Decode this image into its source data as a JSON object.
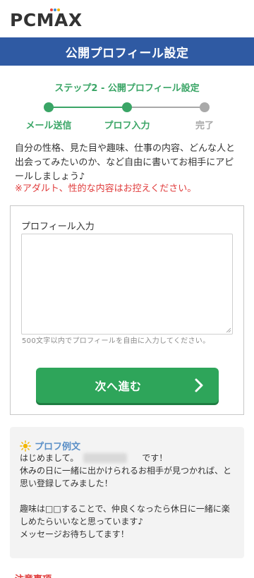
{
  "logo": {
    "text": "PCMAX",
    "dot_colors": [
      "#e8443a",
      "#3a8fd8",
      "#f0b400"
    ]
  },
  "header": {
    "title": "公開プロフィール設定"
  },
  "step_title": "ステップ2 - 公開プロフィール設定",
  "stepper": {
    "steps": [
      {
        "label": "メール送信",
        "state": "done"
      },
      {
        "label": "プロフ入力",
        "state": "current"
      },
      {
        "label": "完了",
        "state": "pending"
      }
    ],
    "active_color": "#3aa566",
    "inactive_color": "#a9a9a9"
  },
  "intro": {
    "text": "自分の性格、見た目や趣味、仕事の内容、どんな人と出会ってみたいのか、など自由に書いてお相手にアピールしましょう♪"
  },
  "warning": {
    "text": "※アダルト、性的な内容はお控えください。"
  },
  "form": {
    "label": "プロフィール入力",
    "value": "",
    "hint": "500文字以内でプロフィールを自由に入力してください。",
    "next_button": "次へ進む"
  },
  "example": {
    "title": "プロフ例文",
    "body": "はじめまして。　　　　　　　　です！\n休みの日に一緒に出かけられるお相手が見つかれば、と思い登録してみました！\n\n趣味は□□することで、仲良くなったら休日に一緒に楽しめたらいいなと思っています♪\nメッセージお待ちしてます！"
  },
  "bottom_heading": "注意事項"
}
